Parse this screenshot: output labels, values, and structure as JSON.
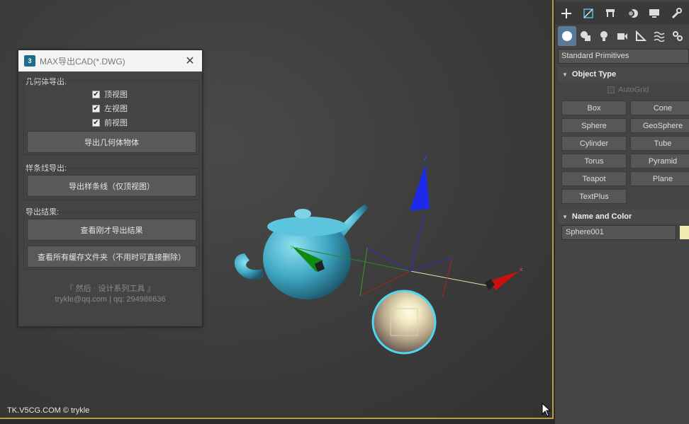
{
  "dialog": {
    "icon_text": "3",
    "title": "MAX导出CAD(*.DWG)",
    "close": "✕",
    "geometry_group": {
      "label": "几何体导出:",
      "checks": [
        {
          "label": "顶视图",
          "checked": true
        },
        {
          "label": "左视图",
          "checked": true
        },
        {
          "label": "前视图",
          "checked": true
        }
      ],
      "button": "导出几何体物体"
    },
    "spline_group": {
      "label": "样条线导出:",
      "button": "导出样条线（仅顶视图）"
    },
    "result_group": {
      "label": "导出结果:",
      "button_view": "查看刚才导出结果",
      "button_cache": "查看所有缓存文件夹（不用时可直接删除）"
    },
    "footer_line1": "『 然后 · 设计系列工具 』",
    "footer_line2": "trykle@qq.com | qq: 294986636"
  },
  "viewport": {
    "watermark": "TK.V5CG.COM © trykle",
    "axis_labels": {
      "x": "x",
      "y": "y",
      "z": "z"
    }
  },
  "command_panel": {
    "main_tabs": [
      "plus-icon",
      "modify-icon",
      "hierarchy-icon",
      "motion-icon",
      "display-icon",
      "utilities-icon"
    ],
    "sub_tabs": [
      "geometry-icon",
      "shapes-icon",
      "lights-icon",
      "cameras-icon",
      "helpers-icon",
      "spacewarps-icon",
      "systems-icon"
    ],
    "category": "Standard Primitives",
    "object_type": {
      "header": "Object Type",
      "autogrid": "AutoGrid",
      "buttons": [
        "Box",
        "Cone",
        "Sphere",
        "GeoSphere",
        "Cylinder",
        "Tube",
        "Torus",
        "Pyramid",
        "Teapot",
        "Plane",
        "TextPlus"
      ]
    },
    "name_color": {
      "header": "Name and Color",
      "name_value": "Sphere001",
      "color": "#f2ecb4"
    }
  },
  "colors": {
    "selection_highlight": "#4fd6f0",
    "teapot": "#4fb8d0",
    "viewport_border": "#b8a040"
  }
}
